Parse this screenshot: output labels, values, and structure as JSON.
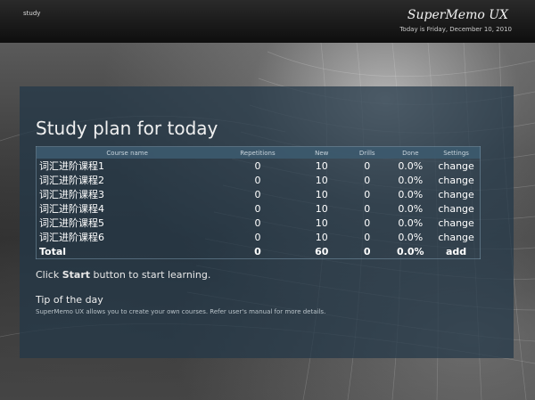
{
  "header": {
    "tab_label": "study",
    "app_title": "SuperMemo UX",
    "date_text": "Today is Friday, December 10, 2010"
  },
  "plan": {
    "title": "Study plan for today",
    "columns": [
      "Course name",
      "Repetitions",
      "New",
      "Drills",
      "Done",
      "Settings"
    ],
    "rows": [
      {
        "name": "词汇进阶课程1",
        "repetitions": "0",
        "new": "10",
        "drills": "0",
        "done": "0.0%",
        "settings": "change"
      },
      {
        "name": "词汇进阶课程2",
        "repetitions": "0",
        "new": "10",
        "drills": "0",
        "done": "0.0%",
        "settings": "change"
      },
      {
        "name": "词汇进阶课程3",
        "repetitions": "0",
        "new": "10",
        "drills": "0",
        "done": "0.0%",
        "settings": "change"
      },
      {
        "name": "词汇进阶课程4",
        "repetitions": "0",
        "new": "10",
        "drills": "0",
        "done": "0.0%",
        "settings": "change"
      },
      {
        "name": "词汇进阶课程5",
        "repetitions": "0",
        "new": "10",
        "drills": "0",
        "done": "0.0%",
        "settings": "change"
      },
      {
        "name": "词汇进阶课程6",
        "repetitions": "0",
        "new": "10",
        "drills": "0",
        "done": "0.0%",
        "settings": "change"
      }
    ],
    "total": {
      "name": "Total",
      "repetitions": "0",
      "new": "60",
      "drills": "0",
      "done": "0.0%",
      "settings": "add"
    }
  },
  "hint": {
    "before": "Click ",
    "strong": "Start",
    "after": " button to start learning."
  },
  "tip": {
    "title": "Tip of the day",
    "text": "SuperMemo UX allows you to create your own courses. Refer user's manual for more details."
  }
}
